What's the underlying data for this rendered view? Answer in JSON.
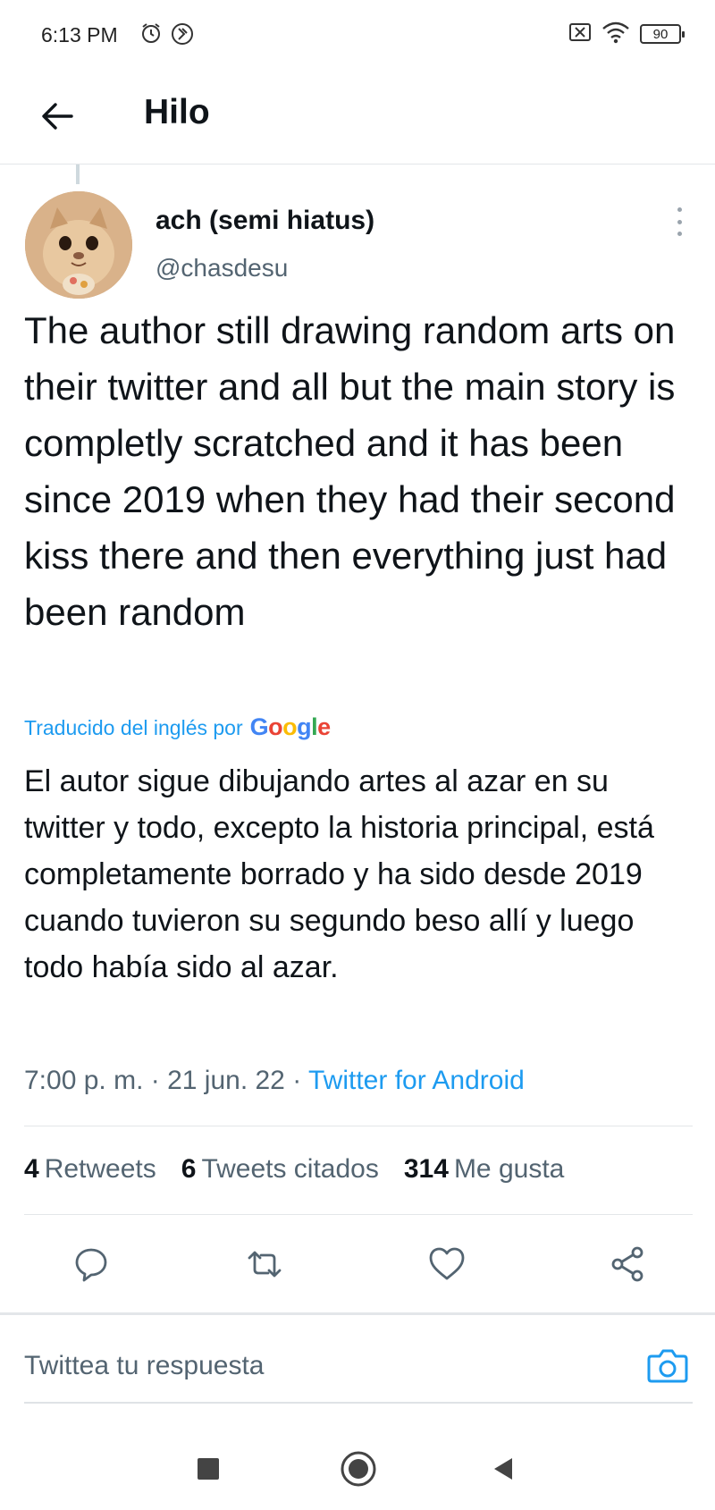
{
  "status_bar": {
    "time": "6:13 PM",
    "battery": "90",
    "icons": [
      "alarm-icon",
      "sync-icon",
      "sim-off-icon",
      "wifi-icon",
      "battery-icon"
    ]
  },
  "header": {
    "title": "Hilo",
    "back_icon": "arrow-left-icon"
  },
  "tweet": {
    "author_name": "ach (semi hiatus)",
    "handle": "@chasdesu",
    "text": "The author still drawing random arts on their twitter and all but the main story is completly scratched and it has been since 2019 when they had their second kiss there and then everything just had been random",
    "translated_label": "Traducido del inglés por",
    "translator": "Google",
    "translation": "El autor sigue dibujando artes al azar en su twitter y todo, excepto la historia principal, está completamente borrado y ha sido desde 2019 cuando tuvieron su segundo beso allí y luego todo había sido al azar.",
    "time": "7:00 p. m.",
    "separator": "·",
    "date": "21 jun. 22",
    "source": "Twitter for Android"
  },
  "stats": {
    "retweets_count": "4",
    "retweets_label": "Retweets",
    "quotes_count": "6",
    "quotes_label": "Tweets citados",
    "likes_count": "314",
    "likes_label": "Me gusta"
  },
  "actions": [
    "reply-icon",
    "retweet-icon",
    "like-icon",
    "share-icon"
  ],
  "reply": {
    "placeholder": "Twittea tu respuesta"
  },
  "nav": [
    "recents-icon",
    "home-icon",
    "back-triangle-icon"
  ],
  "colors": {
    "accent": "#1d9bf0",
    "text": "#0f1419",
    "secondary": "#536471",
    "divider": "#e3e6e9"
  }
}
